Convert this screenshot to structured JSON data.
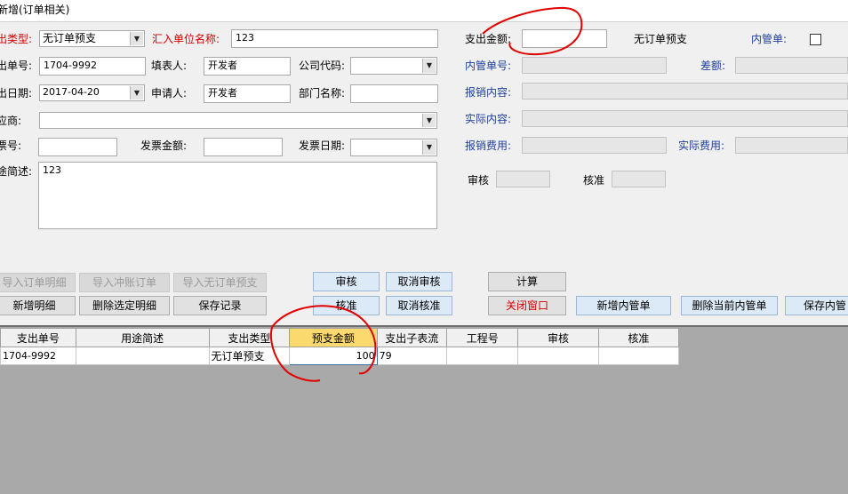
{
  "window": {
    "title": "新增(订单相关)"
  },
  "form_left": {
    "expense_type_label": "出类型:",
    "expense_type_value": "无订单预支",
    "payee_name_label": "汇入单位名称:",
    "payee_name_value": "123",
    "expense_no_label": "出单号:",
    "expense_no_value": "1704-9992",
    "filler_label": "填表人:",
    "filler_value": "开发者",
    "company_code_label": "公司代码:",
    "company_code_value": "",
    "date_label": "出日期:",
    "date_value": "2017-04-20",
    "applicant_label": "申请人:",
    "applicant_value": "开发者",
    "dept_name_label": "部门名称:",
    "dept_name_value": "",
    "supplier_label": "应商:",
    "supplier_value": "",
    "invoice_no_label": "票号:",
    "invoice_no_value": "",
    "invoice_amount_label": "发票金额:",
    "invoice_amount_value": "",
    "invoice_date_label": "发票日期:",
    "invoice_date_value": "",
    "purpose_label": "途简述:",
    "purpose_value": "123"
  },
  "form_right": {
    "expense_amount_label": "支出金额:",
    "expense_amount_value": "",
    "no_order_label": "无订单预支",
    "internal_label": "内管单:",
    "internal_no_label": "内管单号:",
    "internal_no_value": "",
    "diff_label": "差额:",
    "diff_value": "",
    "reimb_content_label": "报销内容:",
    "reimb_content_value": "",
    "actual_content_label": "实际内容:",
    "actual_content_value": "",
    "reimb_fee_label": "报销费用:",
    "reimb_fee_value": "",
    "actual_fee_label": "实际费用:",
    "actual_fee_value": "",
    "audit_label": "审核",
    "audit_value": "",
    "approve_label": "核准",
    "approve_value": ""
  },
  "buttons": {
    "import_order_detail": "导入订单明细",
    "import_offset_order": "导入冲账订单",
    "import_no_order_advance": "导入无订单预支",
    "add_detail": "新增明细",
    "delete_selected_detail": "删除选定明细",
    "save_record": "保存记录",
    "audit": "审核",
    "cancel_audit": "取消审核",
    "approve": "核准",
    "cancel_approve": "取消核准",
    "calculate": "计算",
    "close_window": "关闭窗口",
    "add_internal": "新增内管单",
    "delete_current_internal": "删除当前内管单",
    "save_internal": "保存内管"
  },
  "grid": {
    "columns": [
      "支出单号",
      "用途简述",
      "支出类型",
      "预支金额",
      "支出子表流",
      "工程号",
      "审核",
      "核准"
    ],
    "rows": [
      [
        "1704-9992",
        "",
        "无订单预支",
        "100",
        "79",
        "",
        "",
        ""
      ]
    ]
  },
  "colors": {
    "accent_red": "#d40000",
    "accent_blue": "#1f3f9f",
    "highlight_header": "#fbd96e",
    "annotation_red": "#e00000"
  }
}
